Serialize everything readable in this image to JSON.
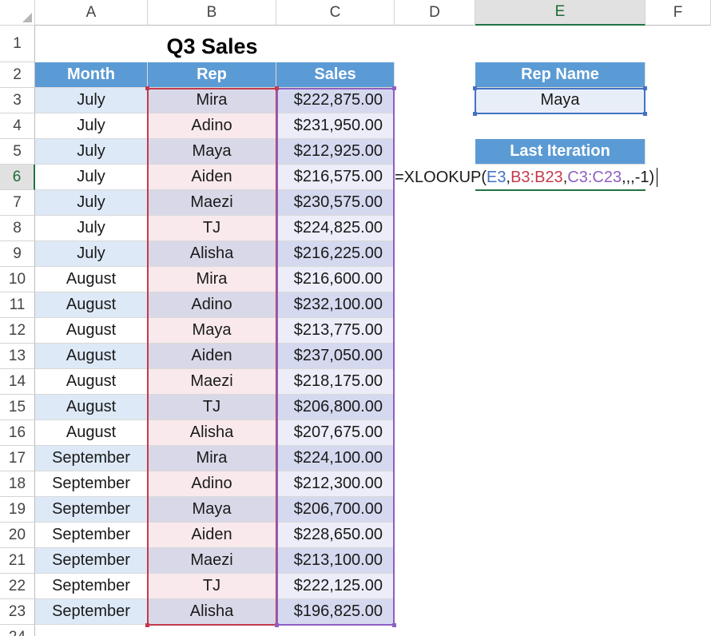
{
  "columns": [
    "A",
    "B",
    "C",
    "D",
    "E",
    "F"
  ],
  "selected_column": "E",
  "rows": [
    "1",
    "2",
    "3",
    "4",
    "5",
    "6",
    "7",
    "8",
    "9",
    "10",
    "11",
    "12",
    "13",
    "14",
    "15",
    "16",
    "17",
    "18",
    "19",
    "20",
    "21",
    "22",
    "23",
    "24"
  ],
  "selected_row": "6",
  "title": "Q3 Sales",
  "headers": {
    "month": "Month",
    "rep": "Rep",
    "sales": "Sales"
  },
  "table": [
    {
      "month": "July",
      "rep": "Mira",
      "sales": "$222,875.00"
    },
    {
      "month": "July",
      "rep": "Adino",
      "sales": "$231,950.00"
    },
    {
      "month": "July",
      "rep": "Maya",
      "sales": "$212,925.00"
    },
    {
      "month": "July",
      "rep": "Aiden",
      "sales": "$216,575.00"
    },
    {
      "month": "July",
      "rep": "Maezi",
      "sales": "$230,575.00"
    },
    {
      "month": "July",
      "rep": "TJ",
      "sales": "$224,825.00"
    },
    {
      "month": "July",
      "rep": "Alisha",
      "sales": "$216,225.00"
    },
    {
      "month": "August",
      "rep": "Mira",
      "sales": "$216,600.00"
    },
    {
      "month": "August",
      "rep": "Adino",
      "sales": "$232,100.00"
    },
    {
      "month": "August",
      "rep": "Maya",
      "sales": "$213,775.00"
    },
    {
      "month": "August",
      "rep": "Aiden",
      "sales": "$237,050.00"
    },
    {
      "month": "August",
      "rep": "Maezi",
      "sales": "$218,175.00"
    },
    {
      "month": "August",
      "rep": "TJ",
      "sales": "$206,800.00"
    },
    {
      "month": "August",
      "rep": "Alisha",
      "sales": "$207,675.00"
    },
    {
      "month": "September",
      "rep": "Mira",
      "sales": "$224,100.00"
    },
    {
      "month": "September",
      "rep": "Adino",
      "sales": "$212,300.00"
    },
    {
      "month": "September",
      "rep": "Maya",
      "sales": "$206,700.00"
    },
    {
      "month": "September",
      "rep": "Aiden",
      "sales": "$228,650.00"
    },
    {
      "month": "September",
      "rep": "Maezi",
      "sales": "$213,100.00"
    },
    {
      "month": "September",
      "rep": "TJ",
      "sales": "$222,125.00"
    },
    {
      "month": "September",
      "rep": "Alisha",
      "sales": "$196,825.00"
    }
  ],
  "rep_name_label": "Rep Name",
  "rep_name_value": "Maya",
  "last_iteration_label": "Last Iteration",
  "formula": {
    "prefix": "=XLOOKUP(",
    "arg1": "E3",
    "sep1": ", ",
    "arg2": "B3:B23",
    "sep2": ", ",
    "arg3": "C3:C23",
    "suffix": ",,,-1)"
  },
  "colors": {
    "header_fill": "#5b9bd5",
    "ref_blue": "#4472c4",
    "ref_red": "#c23a4d",
    "ref_purple": "#8e5fc2",
    "selection_green": "#217346"
  }
}
